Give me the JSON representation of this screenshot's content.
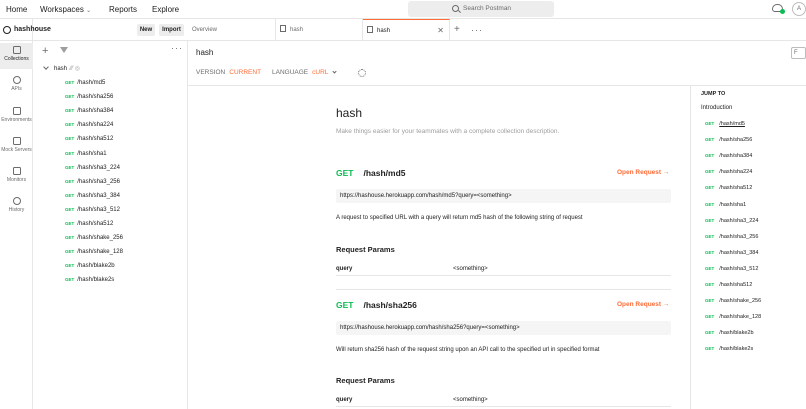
{
  "topbar": {
    "home": "Home",
    "workspaces": "Workspaces",
    "reports": "Reports",
    "explore": "Explore",
    "search_placeholder": "Search Postman"
  },
  "rail": {
    "collections": "Collections",
    "apis": "APIs",
    "environments": "Environments",
    "mock_servers": "Mock Servers",
    "monitors": "Monitors",
    "history": "History"
  },
  "workspace": {
    "name": "hashhouse",
    "new_label": "New",
    "import_label": "Import"
  },
  "collection": {
    "name": "hash",
    "items": [
      "/hash/md5",
      "/hash/sha256",
      "/hash/sha384",
      "/hash/sha224",
      "/hash/sha512",
      "/hash/sha1",
      "/hash/sha3_224",
      "/hash/sha3_256",
      "/hash/sha3_384",
      "/hash/sha3_512",
      "/hash/sha512",
      "/hash/shake_256",
      "/hash/shake_128",
      "/hash/blake2b",
      "/hash/blake2s"
    ],
    "method": "GET"
  },
  "tabs": {
    "overview": "Overview",
    "tab2": "hash",
    "tab3": "hash"
  },
  "doc": {
    "header_title": "hash",
    "side_btn": "F",
    "version_label": "VERSION",
    "version_value": "CURRENT",
    "language_label": "LANGUAGE",
    "language_value": "cURL",
    "title": "hash",
    "description": "Make things easier for your teammates with a complete collection description.",
    "open_request": "Open Request →",
    "params_title": "Request Params",
    "requests": [
      {
        "method": "GET",
        "path": "/hash/md5",
        "url": "https://hashouse.herokuapp.com/hash/md5?query=<something>",
        "desc": "A request to specified URL with a query will return md5 hash of the following string of request",
        "param_key": "query",
        "param_val": "<something>"
      },
      {
        "method": "GET",
        "path": "/hash/sha256",
        "url": "https://hashouse.herokuapp.com/hash/sha256?query=<something>",
        "desc": "Will return sha256 hash of the request string upon an API call to the specified url in specified format",
        "param_key": "query",
        "param_val": "<something>"
      }
    ]
  },
  "jump": {
    "title": "JUMP TO",
    "intro": "Introduction",
    "items": [
      "/hash/md5",
      "/hash/sha256",
      "/hash/sha384",
      "/hash/sha224",
      "/hash/sha512",
      "/hash/sha1",
      "/hash/sha3_224",
      "/hash/sha3_256",
      "/hash/sha3_384",
      "/hash/sha3_512",
      "/hash/sha512",
      "/hash/shake_256",
      "/hash/shake_128",
      "/hash/blake2b",
      "/hash/blake2s"
    ]
  }
}
